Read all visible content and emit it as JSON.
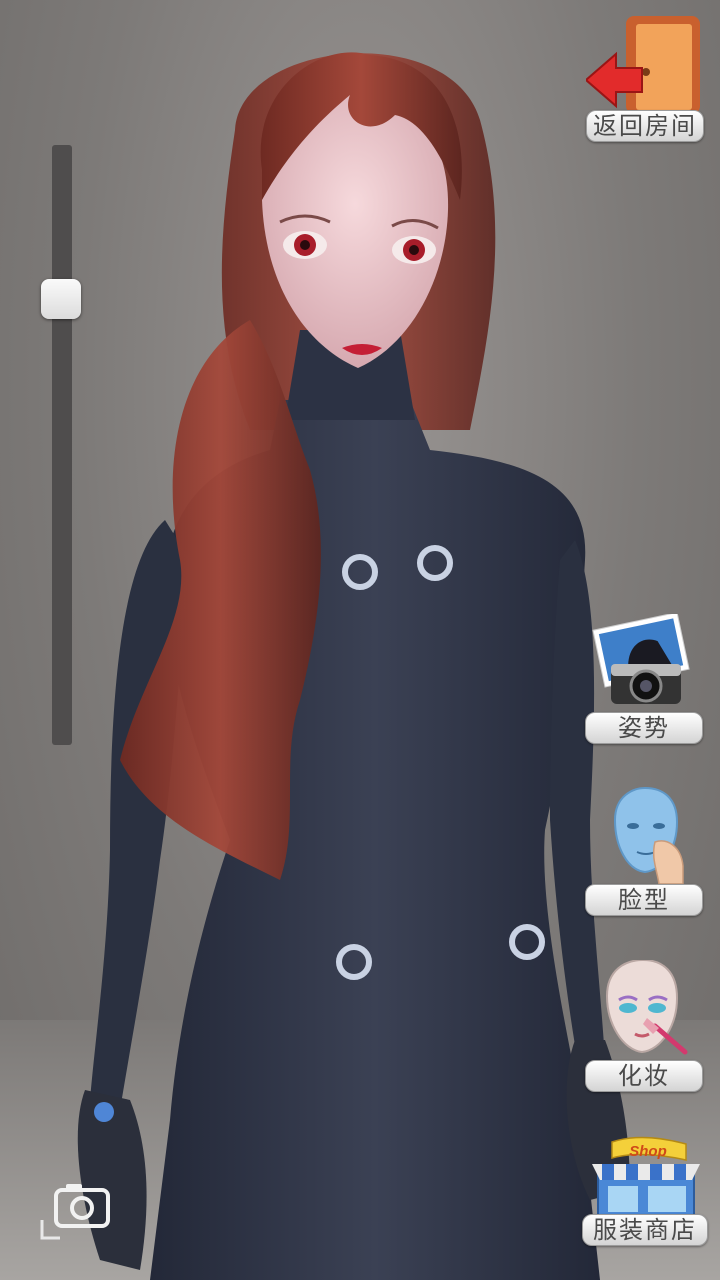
{
  "ui": {
    "back_label": "返回房间",
    "pose_label": "姿势",
    "face_label": "脸型",
    "makeup_label": "化妆",
    "shop_label": "服装商店",
    "shop_sign": "Shop"
  },
  "zoom_slider": {
    "level": 0.24
  },
  "icons": {
    "back": "exit-door-icon",
    "pose": "camera-photo-icon",
    "face": "face-mannequin-icon",
    "makeup": "makeup-brush-icon",
    "shop": "shop-storefront-icon",
    "screenshot": "camera-icon"
  },
  "colors": {
    "suit": "#2f3545",
    "hair": "#8a3a2c",
    "accent_ring": "#c9d2e3",
    "background": "#8a8785"
  }
}
